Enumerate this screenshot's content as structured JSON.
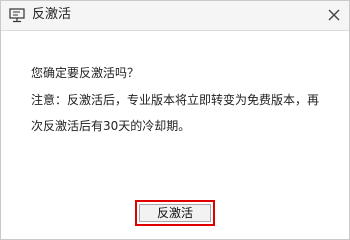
{
  "window": {
    "title": "反激活",
    "app_icon": "monitor-icon",
    "close_icon": "close-icon"
  },
  "message": {
    "question": "您确定要反激活吗？",
    "note_line1": "注意：反激活后，专业版本将立即转变为免费版本，再",
    "note_line2": "次反激活后有30天的冷却期。"
  },
  "actions": {
    "confirm_label": "反激活"
  },
  "colors": {
    "highlight_border": "#e00000"
  }
}
